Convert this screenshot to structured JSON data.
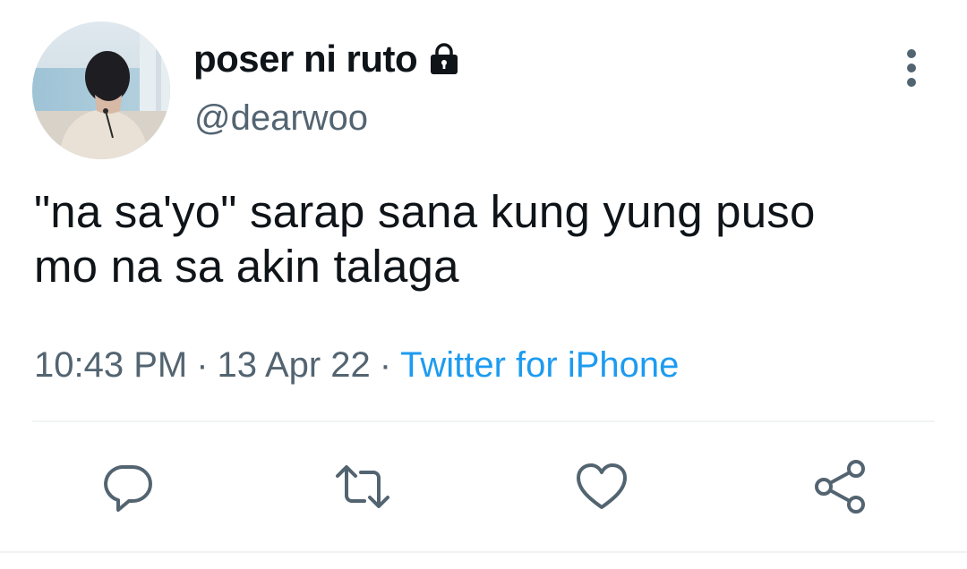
{
  "tweet": {
    "display_name": "poser ni ruto",
    "handle": "@dearwoo",
    "text_line1": "\"na sa'yo\" sarap sana kung yung puso",
    "text_line2": "mo na sa akin talaga",
    "time": "10:43 PM",
    "separator": "·",
    "date": "13 Apr 22",
    "source": "Twitter for iPhone"
  },
  "icons": {
    "lock": "lock-icon",
    "more": "more-vertical-icon",
    "reply": "comment-icon",
    "retweet": "retweet-icon",
    "like": "heart-icon",
    "share": "share-icon"
  },
  "colors": {
    "text": "#0f1419",
    "secondary": "#536471",
    "accent": "#1d9bf0",
    "icon": "#536471",
    "divider": "#eff3f4"
  }
}
